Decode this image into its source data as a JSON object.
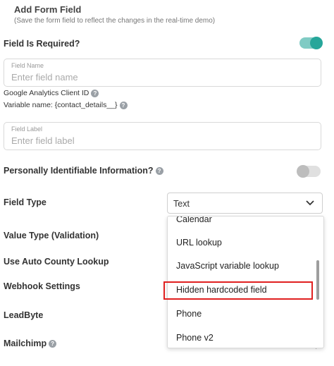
{
  "header": {
    "title": "Add Form Field",
    "subtitle": "(Save the form field to reflect the changes in the real-time demo)"
  },
  "required": {
    "label": "Field Is Required?",
    "on": true
  },
  "field_name": {
    "label": "Field Name",
    "placeholder": "Enter field name"
  },
  "ga": {
    "label": "Google Analytics Client ID",
    "variable": "Variable name: {contact_details__}"
  },
  "field_label": {
    "label": "Field Label",
    "placeholder": "Enter field label"
  },
  "pii": {
    "label": "Personally Identifiable Information?",
    "on": false
  },
  "field_type": {
    "label": "Field Type",
    "selected": "Text",
    "options": [
      "Calendar",
      "URL lookup",
      "JavaScript variable lookup",
      "Hidden hardcoded field",
      "Phone",
      "Phone v2"
    ],
    "highlighted": "Hidden hardcoded field"
  },
  "rows": {
    "value_type": "Value Type (Validation)",
    "auto_county": "Use Auto County Lookup",
    "webhook": "Webhook Settings",
    "leadbyte": "LeadByte",
    "mailchimp": "Mailchimp"
  },
  "colors": {
    "accent": "#26a69a",
    "accent_light": "#80cbc4",
    "highlight": "#e02020"
  },
  "icons": {
    "help": "help-circle-icon",
    "chevron": "chevron-down-icon"
  }
}
